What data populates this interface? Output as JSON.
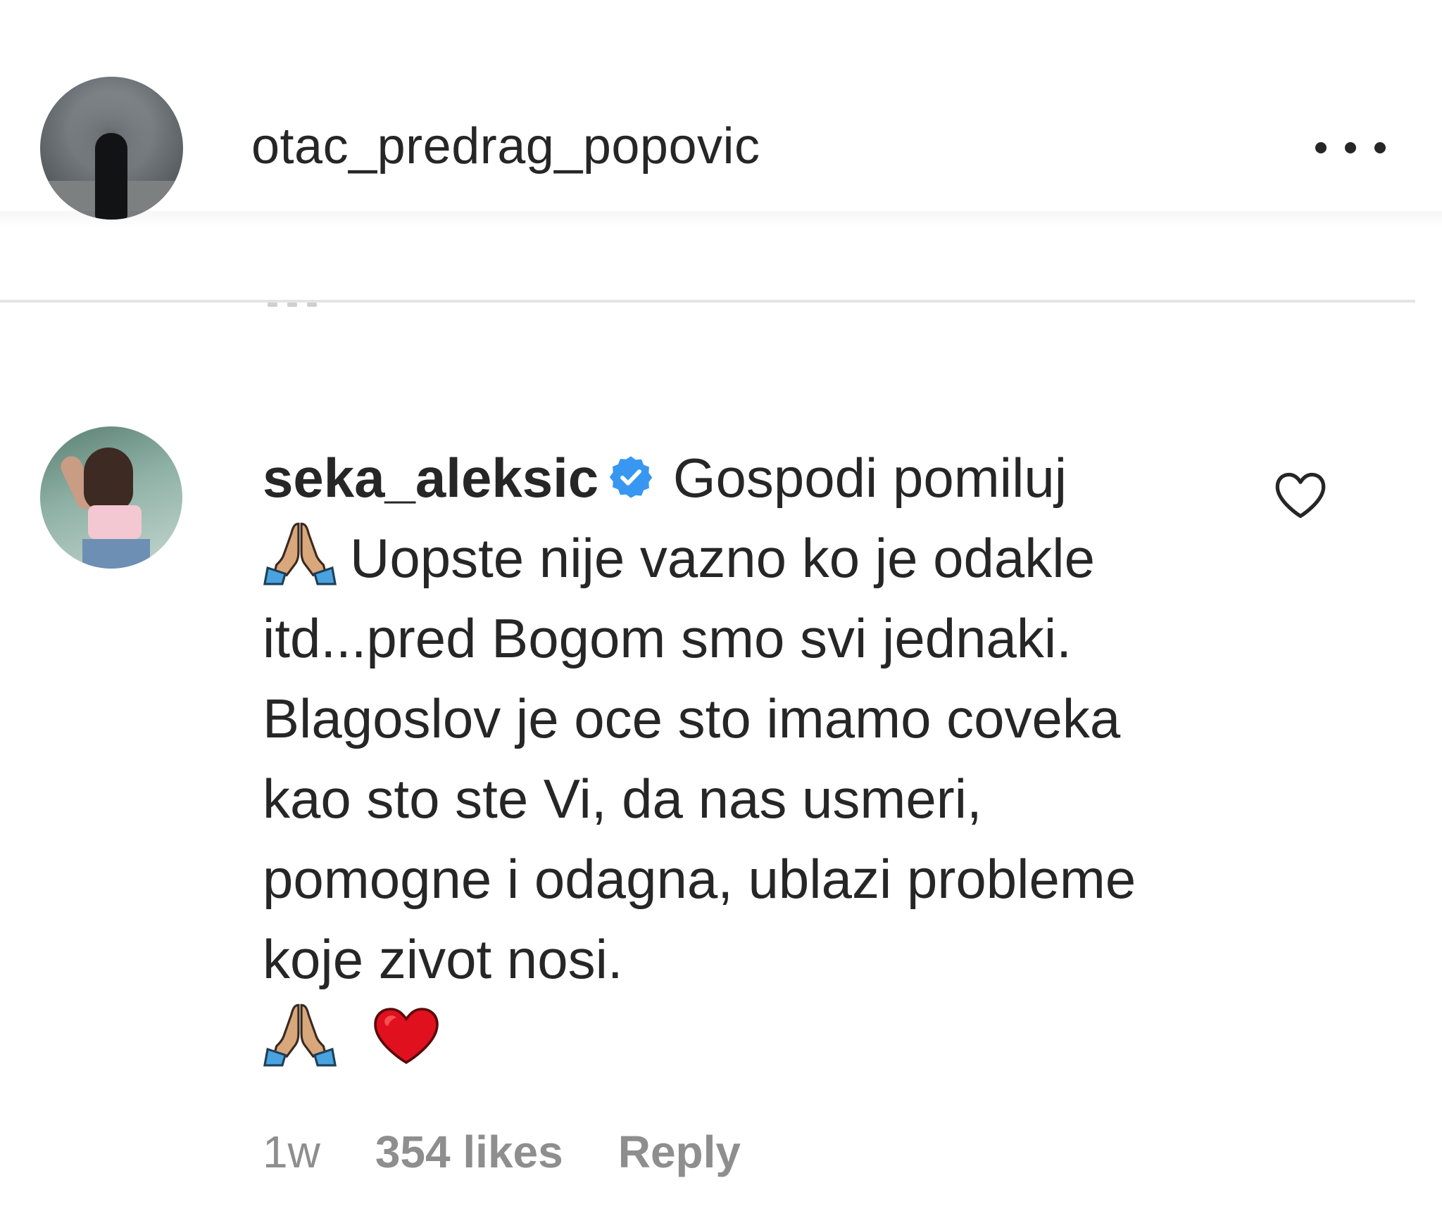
{
  "post_header": {
    "username": "otac_predrag_popovic",
    "more_icon": "more-options-icon"
  },
  "comment": {
    "username": "seka_aleksic",
    "verified": true,
    "text_part1": "Gospodi pomiluj",
    "text_part2": "Uopste nije vazno ko je odakle itd...pred Bogom smo svi jednaki. Blagoslov je oce sto imamo coveka kao sto ste Vi, da nas usmeri, pomogne i odagna, ublazi probleme koje zivot nosi.",
    "emojis": [
      "praying-hands-emoji",
      "praying-hands-emoji",
      "red-heart-emoji"
    ],
    "time": "1w",
    "likes": "354 likes",
    "reply_label": "Reply",
    "like_icon": "heart-outline-icon"
  },
  "colors": {
    "text": "#262626",
    "muted": "#8e8e8e",
    "verified": "#3897f0",
    "heart": "#e0101e",
    "divider": "#e4e4e4"
  }
}
